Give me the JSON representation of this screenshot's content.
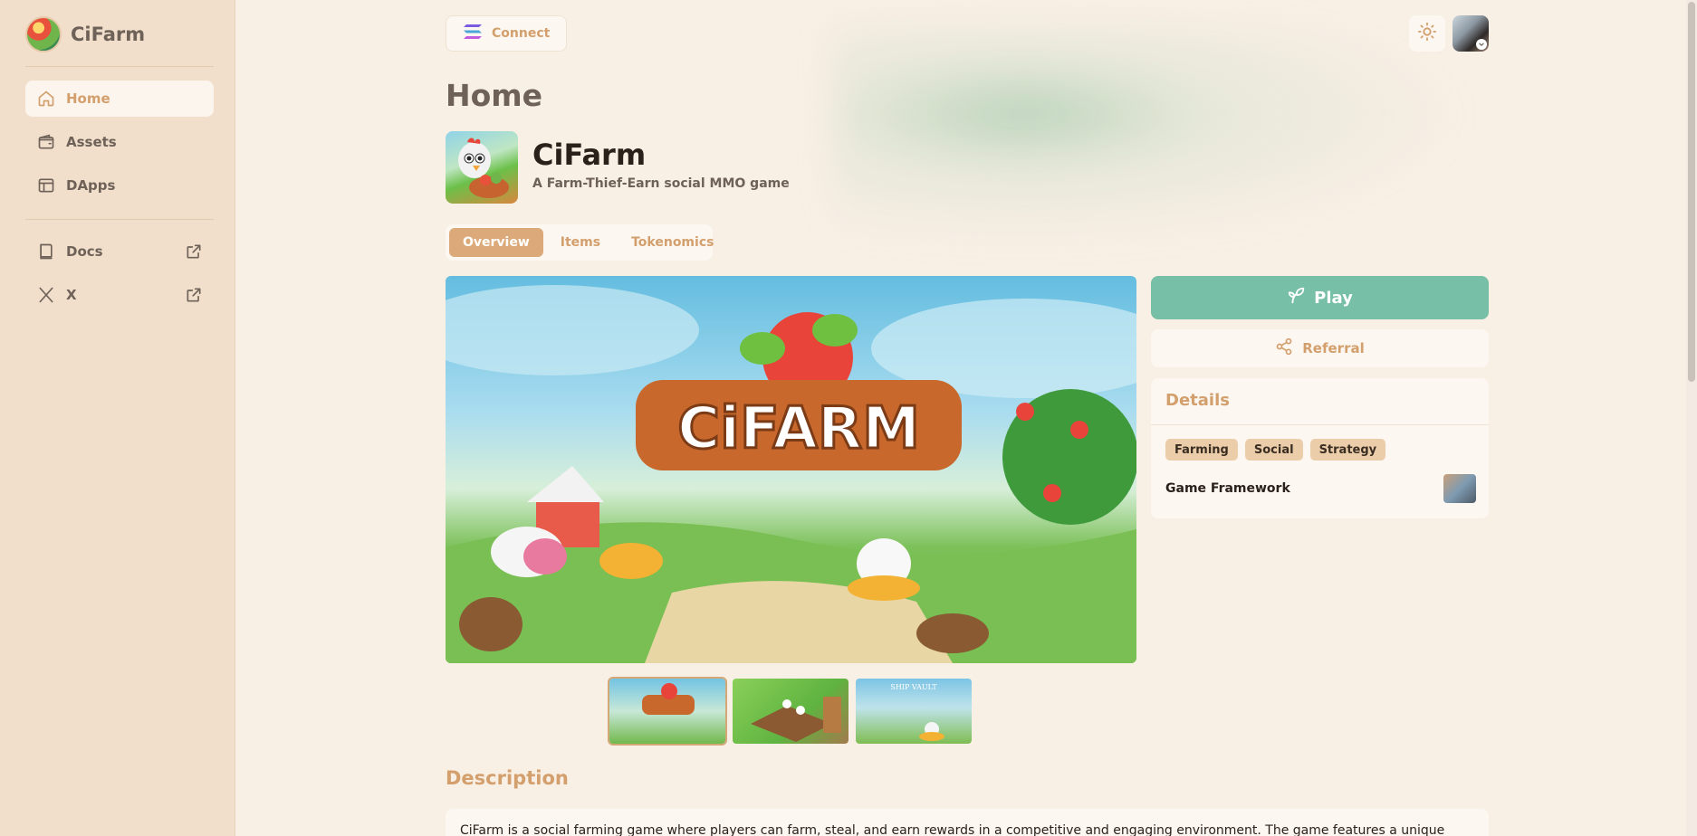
{
  "brand": {
    "name": "CiFarm"
  },
  "sidebar": {
    "items": [
      {
        "label": "Home",
        "icon": "home-icon",
        "active": true
      },
      {
        "label": "Assets",
        "icon": "wallet-icon",
        "active": false
      },
      {
        "label": "DApps",
        "icon": "layout-icon",
        "active": false
      }
    ],
    "external": [
      {
        "label": "Docs",
        "icon": "book-icon"
      },
      {
        "label": "X",
        "icon": "x-logo-icon"
      }
    ]
  },
  "header": {
    "connect_label": "Connect"
  },
  "page": {
    "title": "Home"
  },
  "game": {
    "name": "CiFarm",
    "tagline": "A Farm-Thief-Earn social MMO game",
    "tabs": [
      {
        "label": "Overview",
        "active": true
      },
      {
        "label": "Items",
        "active": false
      },
      {
        "label": "Tokenomics",
        "active": false
      }
    ],
    "hero_logo_text": "CiFARM",
    "thumb_3_caption": "SHIP VAULT"
  },
  "actions": {
    "play_label": "Play",
    "referral_label": "Referral"
  },
  "details": {
    "title": "Details",
    "tags": [
      "Farming",
      "Social",
      "Strategy"
    ],
    "framework_label": "Game Framework"
  },
  "description": {
    "title": "Description",
    "text": "CiFarm is a social farming game where players can farm, steal, and earn rewards in a competitive and engaging environment. The game features a unique"
  },
  "colors": {
    "accent": "#d39f6c",
    "play_button": "#77bfa6",
    "sidebar_bg": "#f1dfcc",
    "page_bg": "#f8efe5"
  }
}
